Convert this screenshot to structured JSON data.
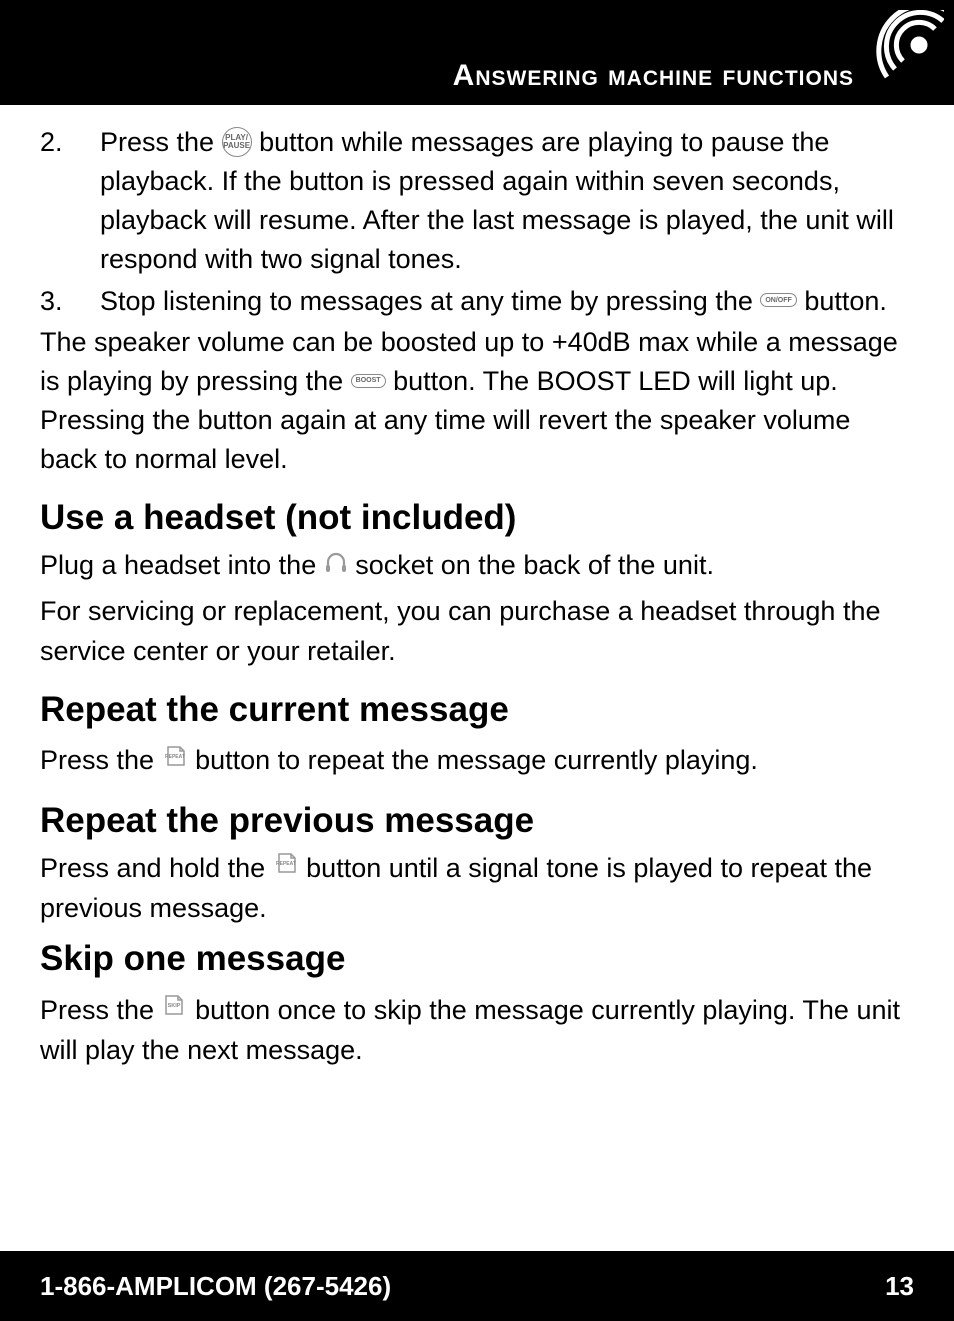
{
  "header": {
    "title": "Answering machine functions"
  },
  "body": {
    "item2_num": "2.",
    "item2_a": "Press the ",
    "item2_b": " button while messages are playing to pause the playback. If the button is pressed again within seven seconds, playback will resume. After the last message is played, the unit will respond with two signal tones.",
    "item3_num": "3.",
    "item3_a": "Stop listening to messages at any time by pressing the ",
    "item3_b": " button.",
    "boost_a": "The speaker volume can be boosted up to +40dB max while a message is playing by pressing the ",
    "boost_b": " button. The BOOST LED will light up. Pressing the   button again at any time will revert the speaker volume back to normal level.",
    "h_headset": "Use a headset (not included)",
    "headset_a": "Plug a headset into the ",
    "headset_b": " socket on the back of the unit.",
    "headset_service": "For servicing or replacement, you can purchase a headset through the service center or your retailer.",
    "h_repeat_current": "Repeat the current message",
    "repeat_current_a": "Press the ",
    "repeat_current_b": " button to repeat the message currently playing.",
    "h_repeat_prev": "Repeat the previous message",
    "repeat_prev_a": "Press and hold the ",
    "repeat_prev_b": " button until a signal tone is played to repeat the previous message.",
    "h_skip": "Skip one message",
    "skip_a": "Press the ",
    "skip_b": " button once to skip the message currently playing. The unit will play the next message."
  },
  "icons": {
    "play_pause": "PLAY/\nPAUSE",
    "on_off": "ON/OFF",
    "boost": "BOOST",
    "repeat": "REPEAT",
    "skip": "SKIP"
  },
  "footer": {
    "phone": "1-866-AMPLICOM (267-5426)",
    "page": "13"
  }
}
